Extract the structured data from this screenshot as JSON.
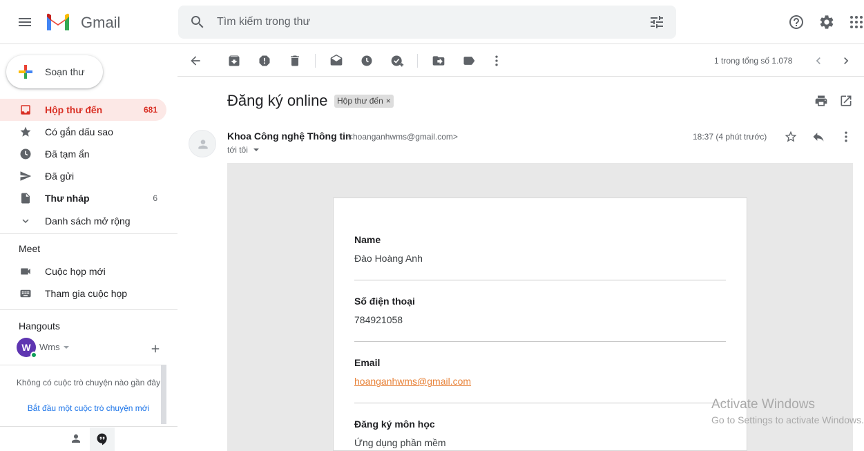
{
  "header": {
    "app_name": "Gmail",
    "search_placeholder": "Tìm kiếm trong thư"
  },
  "sidebar": {
    "compose_label": "Soạn thư",
    "items": [
      {
        "label": "Hộp thư đến",
        "count": "681"
      },
      {
        "label": "Có gắn dấu sao",
        "count": ""
      },
      {
        "label": "Đã tạm ẩn",
        "count": ""
      },
      {
        "label": "Đã gửi",
        "count": ""
      },
      {
        "label": "Thư nháp",
        "count": "6"
      },
      {
        "label": "Danh sách mở rộng",
        "count": ""
      }
    ],
    "meet": {
      "title": "Meet",
      "items": [
        {
          "label": "Cuộc họp mới"
        },
        {
          "label": "Tham gia cuộc họp"
        }
      ]
    },
    "hangouts": {
      "title": "Hangouts",
      "avatar_letter": "W",
      "user": "Wms",
      "empty_text": "Không có cuộc trò chuyện nào gần đây",
      "start_link": "Bắt đầu một cuộc trò chuyện mới"
    }
  },
  "toolbar": {
    "pagination": "1 trong tổng số 1.078"
  },
  "message": {
    "subject": "Đăng ký online",
    "label": "Hộp thư đến",
    "label_close": "×",
    "sender_name": "Khoa Công nghệ Thông tin",
    "sender_email": "<hoanganhwms@gmail.com>",
    "to": "tới tôi",
    "time": "18:37 (4 phút trước)"
  },
  "email_body": {
    "fields": [
      {
        "label": "Name",
        "value": "Đào Hoàng Anh"
      },
      {
        "label": "Số điện thoại",
        "value": "784921058"
      },
      {
        "label": "Email",
        "value": "hoanganhwms@gmail.com"
      },
      {
        "label": "Đăng ký môn học",
        "value": "Ứng dụng phần mềm"
      }
    ]
  },
  "watermark": {
    "title": "Activate Windows",
    "subtitle": "Go to Settings to activate Windows."
  },
  "colors": {
    "accent_red": "#d93025",
    "inbox_active_bg": "#fce8e6",
    "link": "#1a73e8",
    "email_link": "#e8833a"
  }
}
